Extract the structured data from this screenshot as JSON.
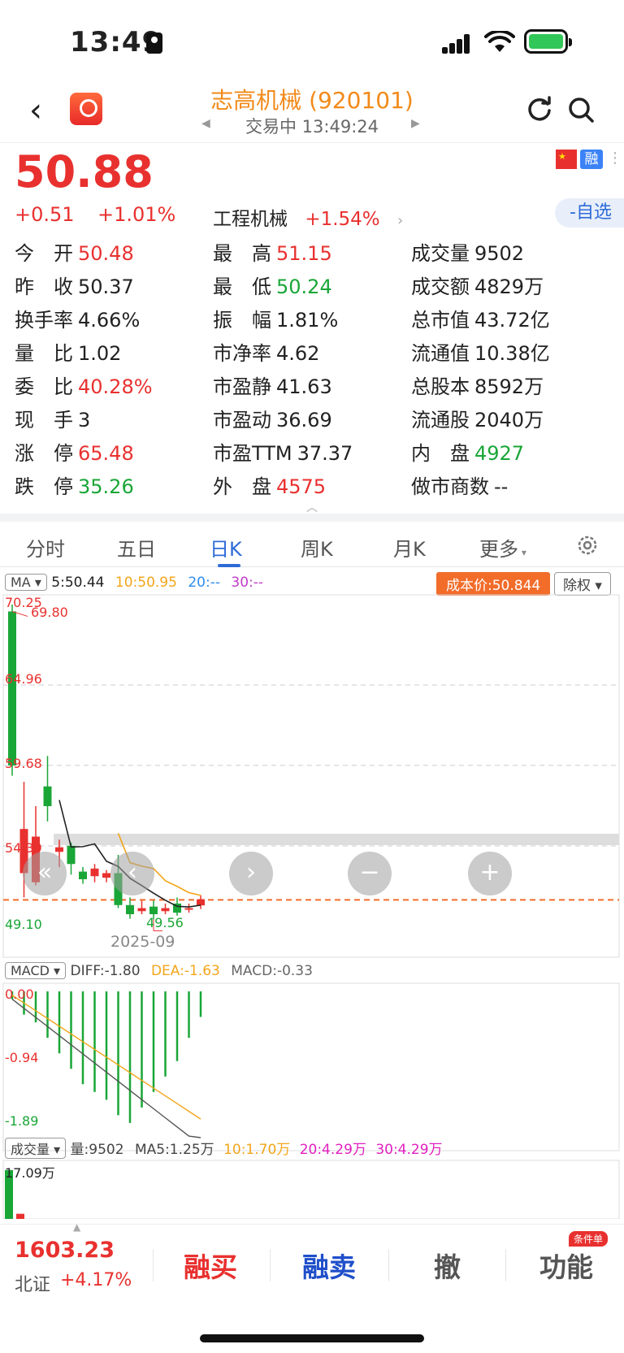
{
  "status_bar": {
    "time": "13:49"
  },
  "nav": {
    "title": "志高机械 (920101)",
    "subtitle": "交易中 13:49:24"
  },
  "quote": {
    "price": "50.88",
    "change": "+0.51",
    "change_pct": "+1.01%",
    "sector_name": "工程机械",
    "sector_pct": "+1.54%",
    "rong_badge": "融",
    "watchlist_label": "-自选"
  },
  "stats": [
    {
      "label": "今　开",
      "value": "50.48",
      "color": "red"
    },
    {
      "label": "最　高",
      "value": "51.15",
      "color": "red"
    },
    {
      "label": "成交量",
      "value": "9502",
      "color": "black"
    },
    {
      "label": "昨　收",
      "value": "50.37",
      "color": "black"
    },
    {
      "label": "最　低",
      "value": "50.24",
      "color": "green"
    },
    {
      "label": "成交额",
      "value": "4829万",
      "color": "black"
    },
    {
      "label": "换手率",
      "value": "4.66%",
      "color": "black"
    },
    {
      "label": "振　幅",
      "value": "1.81%",
      "color": "black"
    },
    {
      "label": "总市值",
      "value": "43.72亿",
      "color": "black"
    },
    {
      "label": "量　比",
      "value": "1.02",
      "color": "black"
    },
    {
      "label": "市净率",
      "value": "4.62",
      "color": "black"
    },
    {
      "label": "流通值",
      "value": "10.38亿",
      "color": "black"
    },
    {
      "label": "委　比",
      "value": "40.28%",
      "color": "red"
    },
    {
      "label": "市盈静",
      "value": "41.63",
      "color": "black"
    },
    {
      "label": "总股本",
      "value": "8592万",
      "color": "black"
    },
    {
      "label": "现　手",
      "value": "3",
      "color": "black"
    },
    {
      "label": "市盈动",
      "value": "36.69",
      "color": "black"
    },
    {
      "label": "流通股",
      "value": "2040万",
      "color": "black"
    },
    {
      "label": "涨　停",
      "value": "65.48",
      "color": "red"
    },
    {
      "label": "市盈TTM",
      "value": "37.37",
      "color": "black"
    },
    {
      "label": "内　盘",
      "value": "4927",
      "color": "green"
    },
    {
      "label": "跌　停",
      "value": "35.26",
      "color": "green"
    },
    {
      "label": "外　盘",
      "value": "4575",
      "color": "red"
    },
    {
      "label": "做市商数",
      "value": "--",
      "color": "black"
    }
  ],
  "tabs": [
    "分时",
    "五日",
    "日K",
    "周K",
    "月K",
    "更多"
  ],
  "active_tab": "日K",
  "kline": {
    "ma_selector": "MA",
    "ma5": "5:50.44",
    "ma10": "10:50.95",
    "ma20": "20:--",
    "ma30": "30:--",
    "cost_price": "成本价:50.844",
    "adjust": "除权",
    "y_labels": [
      "70.25",
      "64.96",
      "59.68",
      "54.39",
      "49.10"
    ],
    "high_mark": "69.80",
    "low_mark": "49.56",
    "date_label": "2025-09"
  },
  "macd": {
    "selector": "MACD",
    "diff": "DIFF:-1.80",
    "dea": "DEA:-1.63",
    "macd": "MACD:-0.33",
    "y_labels": [
      "0.00",
      "-0.94",
      "-1.89"
    ]
  },
  "volume": {
    "selector": "成交量",
    "vol": "量:9502",
    "ma5": "MA5:1.25万",
    "ma10": "10:1.70万",
    "ma20": "20:4.29万",
    "ma30": "30:4.29万",
    "max_label": "17.09万"
  },
  "bottom": {
    "index_value": "1603.23",
    "index_name": "北证",
    "index_change": "+4.17%",
    "buy": "融买",
    "sell": "融卖",
    "cancel": "撤",
    "func": "功能",
    "func_badge": "条件单"
  },
  "chart_data": {
    "type": "candlestick",
    "ylim": [
      49.1,
      70.25
    ],
    "candles": [
      {
        "o": 59.68,
        "c": 69.8,
        "h": 70.25,
        "l": 59.0,
        "dir": "down"
      },
      {
        "o": 55.5,
        "c": 52.6,
        "h": 58.6,
        "l": 51.0,
        "dir": "up"
      },
      {
        "o": 55.0,
        "c": 52.0,
        "h": 57.0,
        "l": 51.8,
        "dir": "up"
      },
      {
        "o": 57.0,
        "c": 58.3,
        "h": 60.3,
        "l": 56.0,
        "dir": "down"
      },
      {
        "o": 54.0,
        "c": 54.3,
        "h": 54.8,
        "l": 53.0,
        "dir": "up"
      },
      {
        "o": 53.2,
        "c": 54.4,
        "h": 54.6,
        "l": 52.5,
        "dir": "down"
      },
      {
        "o": 52.2,
        "c": 52.7,
        "h": 53.0,
        "l": 51.9,
        "dir": "down"
      },
      {
        "o": 52.4,
        "c": 52.9,
        "h": 53.2,
        "l": 52.0,
        "dir": "up"
      },
      {
        "o": 52.3,
        "c": 52.6,
        "h": 52.8,
        "l": 52.0,
        "dir": "up"
      },
      {
        "o": 50.5,
        "c": 52.6,
        "h": 53.8,
        "l": 50.3,
        "dir": "down"
      },
      {
        "o": 49.9,
        "c": 50.5,
        "h": 51.0,
        "l": 49.6,
        "dir": "down"
      },
      {
        "o": 50.1,
        "c": 50.3,
        "h": 50.8,
        "l": 49.9,
        "dir": "up"
      },
      {
        "o": 49.9,
        "c": 50.4,
        "h": 50.8,
        "l": 49.56,
        "dir": "down"
      },
      {
        "o": 50.1,
        "c": 50.3,
        "h": 50.6,
        "l": 49.9,
        "dir": "up"
      },
      {
        "o": 50.0,
        "c": 50.6,
        "h": 51.0,
        "l": 49.8,
        "dir": "down"
      },
      {
        "o": 50.2,
        "c": 50.3,
        "h": 50.6,
        "l": 50.0,
        "dir": "up"
      },
      {
        "o": 50.48,
        "c": 50.88,
        "h": 51.15,
        "l": 50.24,
        "dir": "up"
      }
    ],
    "macd_hist": [
      -0.1,
      -0.3,
      -0.4,
      -0.6,
      -0.8,
      -1.0,
      -1.2,
      -1.3,
      -1.4,
      -1.6,
      -1.7,
      -1.5,
      -1.3,
      -1.1,
      -0.9,
      -0.6,
      -0.33
    ],
    "volume_hist": [
      17.09,
      1.8
    ]
  }
}
